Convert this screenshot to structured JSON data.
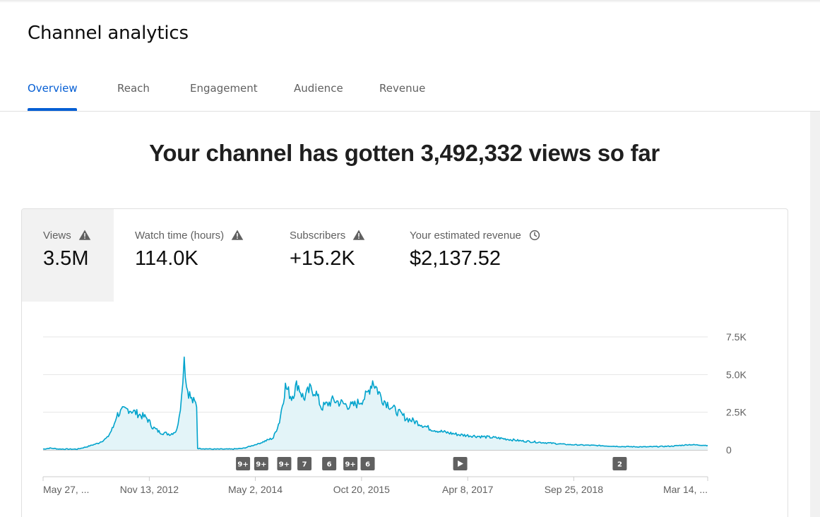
{
  "page": {
    "title": "Channel analytics"
  },
  "tabs": [
    {
      "label": "Overview",
      "active": true
    },
    {
      "label": "Reach",
      "active": false
    },
    {
      "label": "Engagement",
      "active": false
    },
    {
      "label": "Audience",
      "active": false
    },
    {
      "label": "Revenue",
      "active": false
    }
  ],
  "headline": "Your channel has gotten 3,492,332 views so far",
  "metrics": [
    {
      "label": "Views",
      "value": "3.5M",
      "icon": "warning-icon",
      "selected": true
    },
    {
      "label": "Watch time (hours)",
      "value": "114.0K",
      "icon": "warning-icon",
      "selected": false
    },
    {
      "label": "Subscribers",
      "value": "+15.2K",
      "icon": "warning-icon",
      "selected": false
    },
    {
      "label": "Your estimated revenue",
      "value": "$2,137.52",
      "icon": "clock-icon",
      "selected": false
    }
  ],
  "colors": {
    "accent": "#065fd4",
    "series_line": "#00a3cc",
    "series_fill": "#e3f4f8",
    "badge": "#606060"
  },
  "chart_data": {
    "type": "area",
    "series": [
      {
        "points": [
          [
            "2011-05-27",
            0.05
          ],
          [
            "2011-07-01",
            0.12
          ],
          [
            "2011-08-15",
            0.06
          ],
          [
            "2011-10-01",
            0.05
          ],
          [
            "2011-11-15",
            0.05
          ],
          [
            "2012-01-01",
            0.2
          ],
          [
            "2012-03-01",
            0.45
          ],
          [
            "2012-04-15",
            0.8
          ],
          [
            "2012-05-15",
            1.5
          ],
          [
            "2012-06-01",
            2.3
          ],
          [
            "2012-07-01",
            2.6
          ],
          [
            "2012-08-01",
            2.7
          ],
          [
            "2012-09-01",
            2.5
          ],
          [
            "2012-10-01",
            2.3
          ],
          [
            "2012-11-01",
            2.1
          ],
          [
            "2012-12-01",
            1.5
          ],
          [
            "2013-01-01",
            1.2
          ],
          [
            "2013-02-01",
            1.1
          ],
          [
            "2013-03-01",
            1.05
          ],
          [
            "2013-04-01",
            1.3
          ],
          [
            "2013-04-25",
            3.5
          ],
          [
            "2013-05-08",
            6.3
          ],
          [
            "2013-05-20",
            4.2
          ],
          [
            "2013-06-15",
            3.3
          ],
          [
            "2013-07-10",
            3.0
          ],
          [
            "2013-07-15",
            0.1
          ],
          [
            "2013-10-01",
            0.05
          ],
          [
            "2014-01-01",
            0.05
          ],
          [
            "2014-03-01",
            0.1
          ],
          [
            "2014-05-15",
            0.4
          ],
          [
            "2014-08-01",
            0.8
          ],
          [
            "2014-09-01",
            1.9
          ],
          [
            "2014-10-01",
            4.2
          ],
          [
            "2014-11-01",
            3.5
          ],
          [
            "2014-12-01",
            4.4
          ],
          [
            "2015-01-01",
            3.4
          ],
          [
            "2015-02-01",
            4.0
          ],
          [
            "2015-03-01",
            3.9
          ],
          [
            "2015-04-01",
            2.8
          ],
          [
            "2015-06-01",
            3.3
          ],
          [
            "2015-08-01",
            3.0
          ],
          [
            "2015-09-01",
            2.9
          ],
          [
            "2015-10-01",
            3.1
          ],
          [
            "2015-11-15",
            3.6
          ],
          [
            "2015-12-15",
            4.6
          ],
          [
            "2016-02-01",
            3.4
          ],
          [
            "2016-04-01",
            2.7
          ],
          [
            "2016-06-01",
            2.1
          ],
          [
            "2016-08-01",
            1.8
          ],
          [
            "2016-10-01",
            1.4
          ],
          [
            "2016-12-01",
            1.2
          ],
          [
            "2017-03-01",
            1.0
          ],
          [
            "2017-06-01",
            0.9
          ],
          [
            "2017-09-01",
            0.8
          ],
          [
            "2018-01-01",
            0.6
          ],
          [
            "2018-06-01",
            0.45
          ],
          [
            "2018-09-01",
            0.35
          ],
          [
            "2019-01-01",
            0.3
          ],
          [
            "2019-06-01",
            0.22
          ],
          [
            "2019-10-01",
            0.2
          ],
          [
            "2020-02-01",
            0.25
          ],
          [
            "2020-05-01",
            0.35
          ],
          [
            "2020-08-01",
            0.3
          ]
        ]
      }
    ],
    "y_ticks": [
      "7.5K",
      "5.0K",
      "2.5K",
      "0"
    ],
    "y_tick_values": [
      7.5,
      5.0,
      2.5,
      0
    ],
    "ylim": [
      0,
      7.5
    ],
    "x_ticks": [
      "May 27, ...",
      "Nov 13, 2012",
      "May 2, 2014",
      "Oct 20, 2015",
      "Apr 8, 2017",
      "Sep 25, 2018",
      "Mar 14, ..."
    ],
    "x_tick_dates": [
      "2011-05-27",
      "2012-11-13",
      "2014-05-02",
      "2015-10-20",
      "2017-04-08",
      "2018-09-25",
      "2020-03-14"
    ],
    "xlim": [
      "2011-05-27",
      "2020-08-01"
    ],
    "grid": true,
    "annotations": [
      {
        "label": "9+",
        "date": "2014-03-01",
        "kind": "count"
      },
      {
        "label": "9+",
        "date": "2014-06-01",
        "kind": "count"
      },
      {
        "label": "9+",
        "date": "2014-09-25",
        "kind": "count"
      },
      {
        "label": "7",
        "date": "2015-01-05",
        "kind": "count"
      },
      {
        "label": "6",
        "date": "2015-05-10",
        "kind": "count"
      },
      {
        "label": "9+",
        "date": "2015-08-25",
        "kind": "count"
      },
      {
        "label": "6",
        "date": "2015-11-20",
        "kind": "count"
      },
      {
        "label": "",
        "date": "2017-03-01",
        "kind": "play"
      },
      {
        "label": "2",
        "date": "2019-05-15",
        "kind": "count"
      }
    ]
  }
}
